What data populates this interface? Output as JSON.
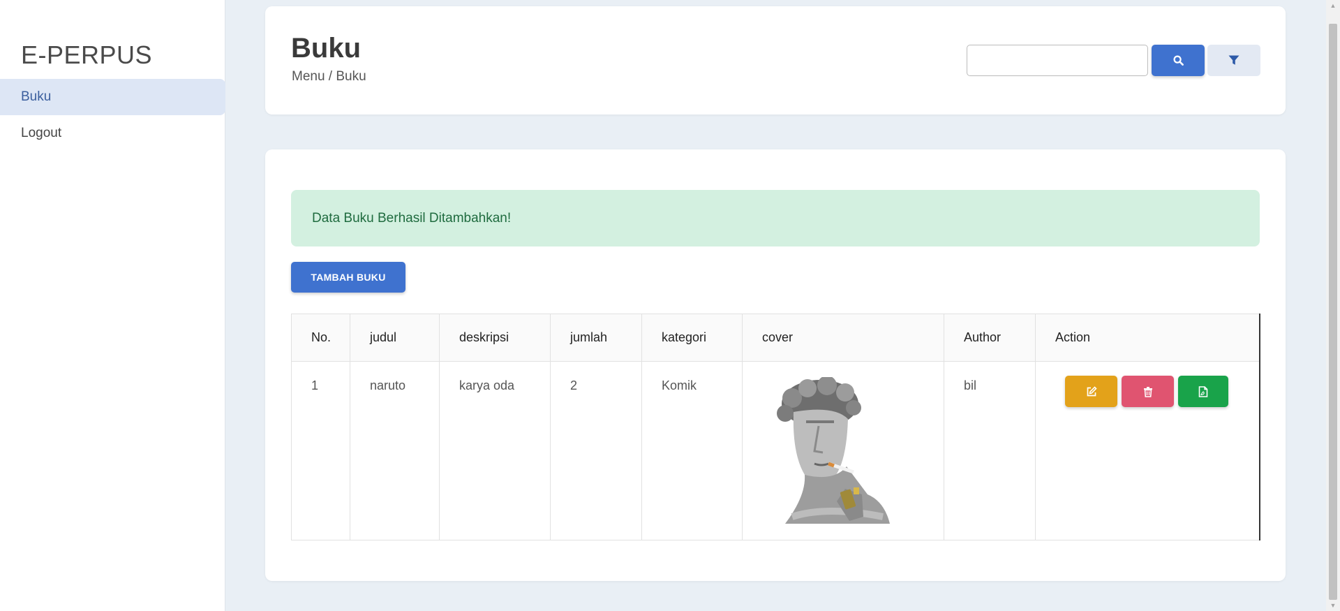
{
  "sidebar": {
    "brand": "E-PERPUS",
    "items": [
      {
        "label": "Buku",
        "active": true
      },
      {
        "label": "Logout",
        "active": false
      }
    ]
  },
  "header": {
    "title": "Buku",
    "breadcrumb": "Menu / Buku",
    "search": {
      "value": "",
      "placeholder": ""
    },
    "icons": {
      "search": "search-icon",
      "filter": "filter-icon"
    }
  },
  "alert": {
    "message": "Data Buku Berhasil Ditambahkan!"
  },
  "toolbar": {
    "add_label": "TAMBAH BUKU"
  },
  "table": {
    "columns": [
      "No.",
      "judul",
      "deskripsi",
      "jumlah",
      "kategori",
      "cover",
      "Author",
      "Action"
    ],
    "rows": [
      {
        "no": "1",
        "judul": "naruto",
        "deskripsi": "karya oda",
        "jumlah": "2",
        "kategori": "Komik",
        "cover": "statue-cover-image",
        "author": "bil",
        "actions": [
          "edit-icon",
          "trash-icon",
          "pdf-icon"
        ]
      }
    ]
  },
  "colors": {
    "primary": "#3f72cf",
    "warning": "#e3a21a",
    "danger": "#e05470",
    "success": "#19a34a",
    "alert_bg": "#d3f0e0",
    "alert_text": "#1f6b3f",
    "page_bg": "#e9eff5"
  }
}
